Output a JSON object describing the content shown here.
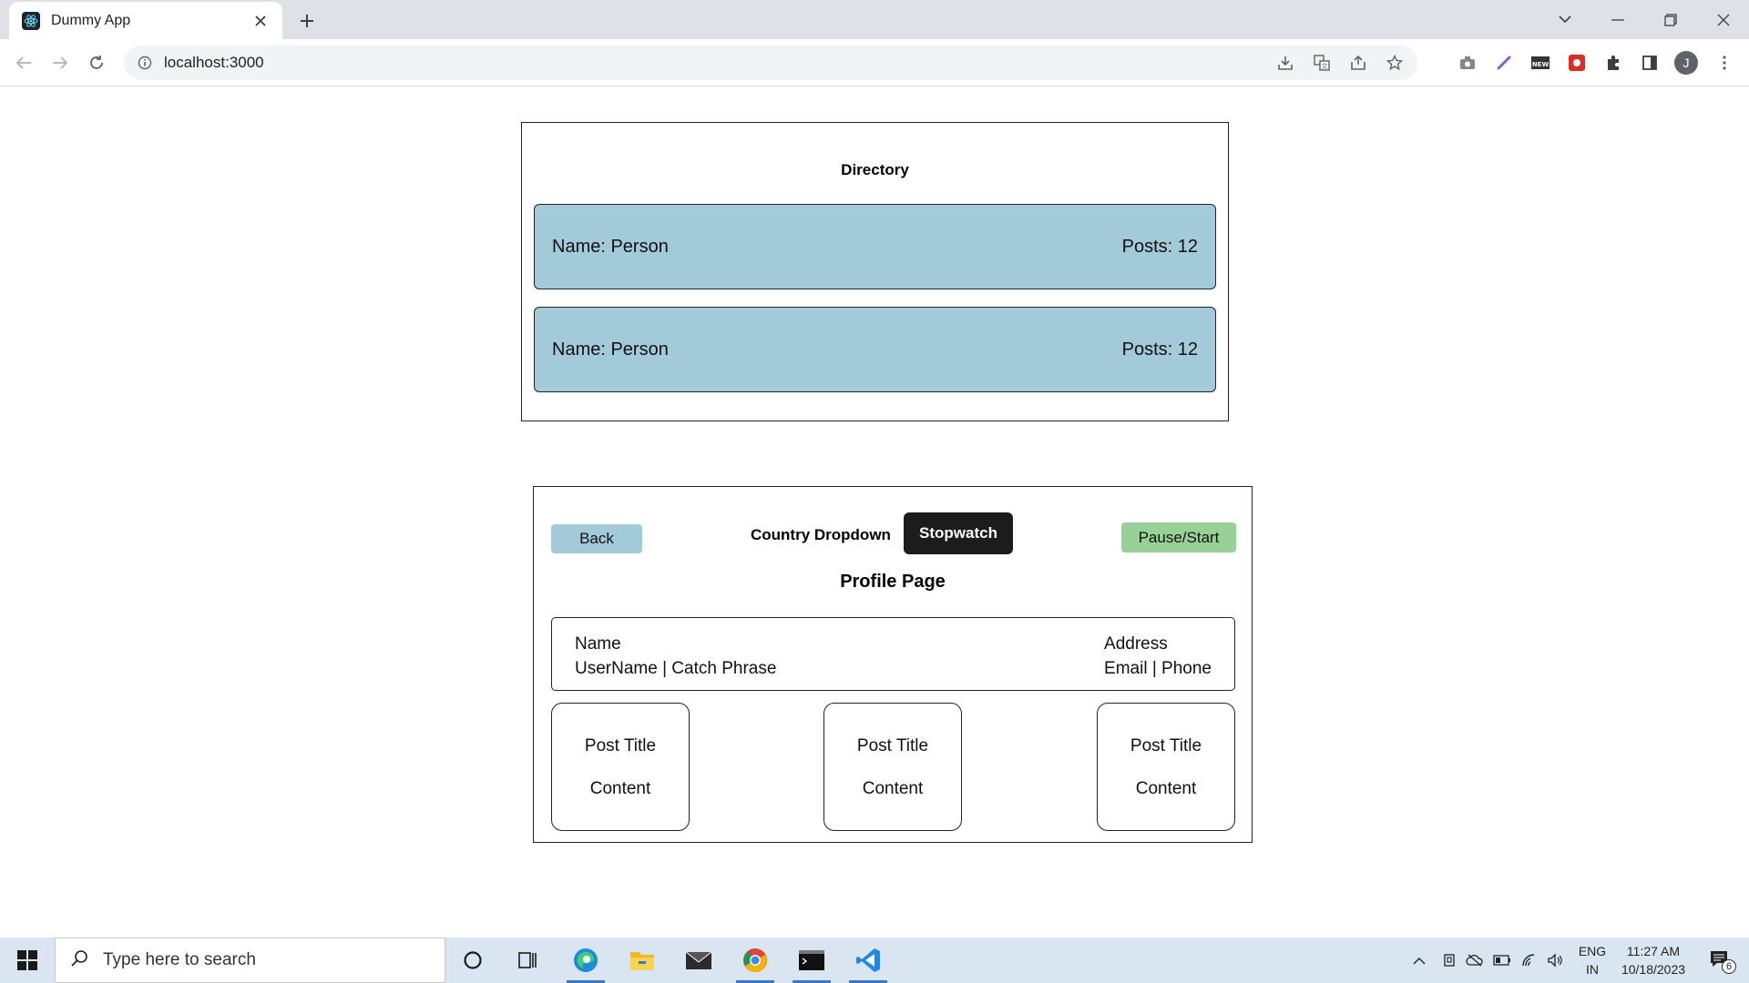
{
  "browser": {
    "tab_title": "Dummy App",
    "url": "localhost:3000",
    "profile_initial": "J"
  },
  "directory": {
    "title": "Directory",
    "people": [
      {
        "name": "Name: Person",
        "posts": "Posts: 12"
      },
      {
        "name": "Name: Person",
        "posts": "Posts: 12"
      }
    ]
  },
  "profile": {
    "back_label": "Back",
    "country_label": "Country Dropdown",
    "stopwatch_label": "Stopwatch",
    "pause_start_label": "Pause/Start",
    "title": "Profile Page",
    "info": {
      "name": "Name",
      "username_catchphrase": "UserName | Catch Phrase",
      "address": "Address",
      "email_phone": "Email | Phone"
    },
    "posts": [
      {
        "title": "Post Title",
        "content": "Content"
      },
      {
        "title": "Post Title",
        "content": "Content"
      },
      {
        "title": "Post Title",
        "content": "Content"
      }
    ]
  },
  "taskbar": {
    "search_placeholder": "Type here to search",
    "lang_top": "ENG",
    "lang_bottom": "IN",
    "time": "11:27 AM",
    "date": "10/18/2023",
    "notification_count": "6"
  },
  "colors": {
    "card_blue": "#a3cad8",
    "pause_green": "#98d197",
    "stopwatch_dark": "#1c1c1c"
  }
}
